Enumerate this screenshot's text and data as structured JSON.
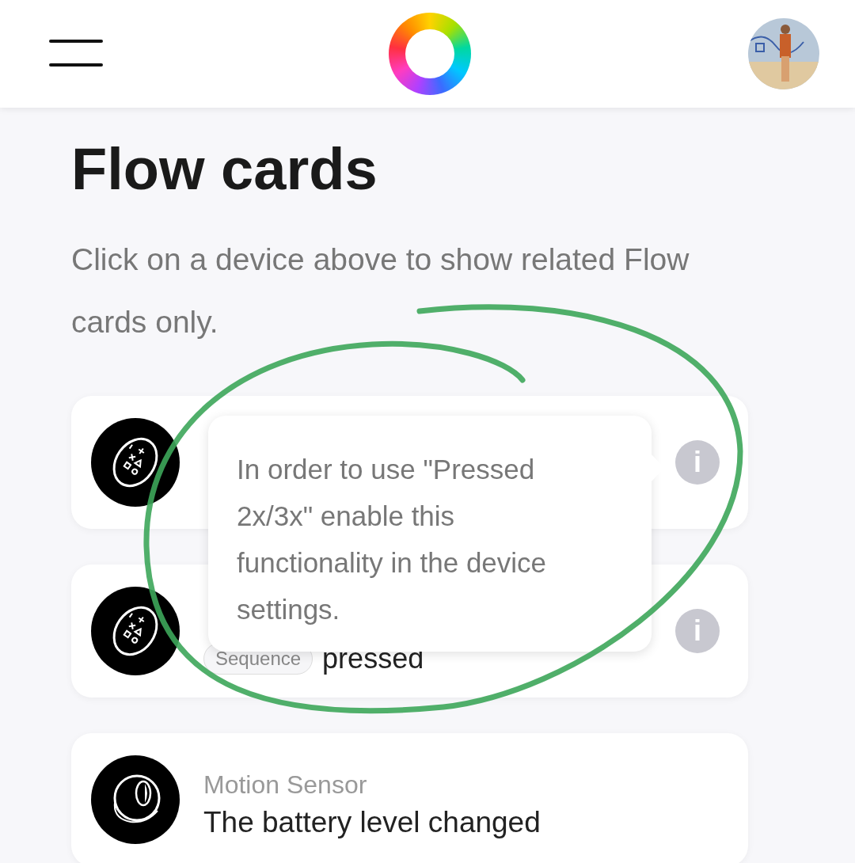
{
  "title": "Flow cards",
  "subtitle": "Click on a device above to show related Flow cards only.",
  "cards": [
    {
      "kind": "button",
      "info": "i"
    },
    {
      "kind": "button",
      "chip": "Sequence",
      "value": "pressed",
      "info": "i"
    },
    {
      "kind": "sensor",
      "device": "Motion Sensor",
      "text": "The battery level changed"
    }
  ],
  "tooltip": {
    "text": "In order to use \"Pressed 2x/3x\" enable this functionality in the device settings."
  }
}
